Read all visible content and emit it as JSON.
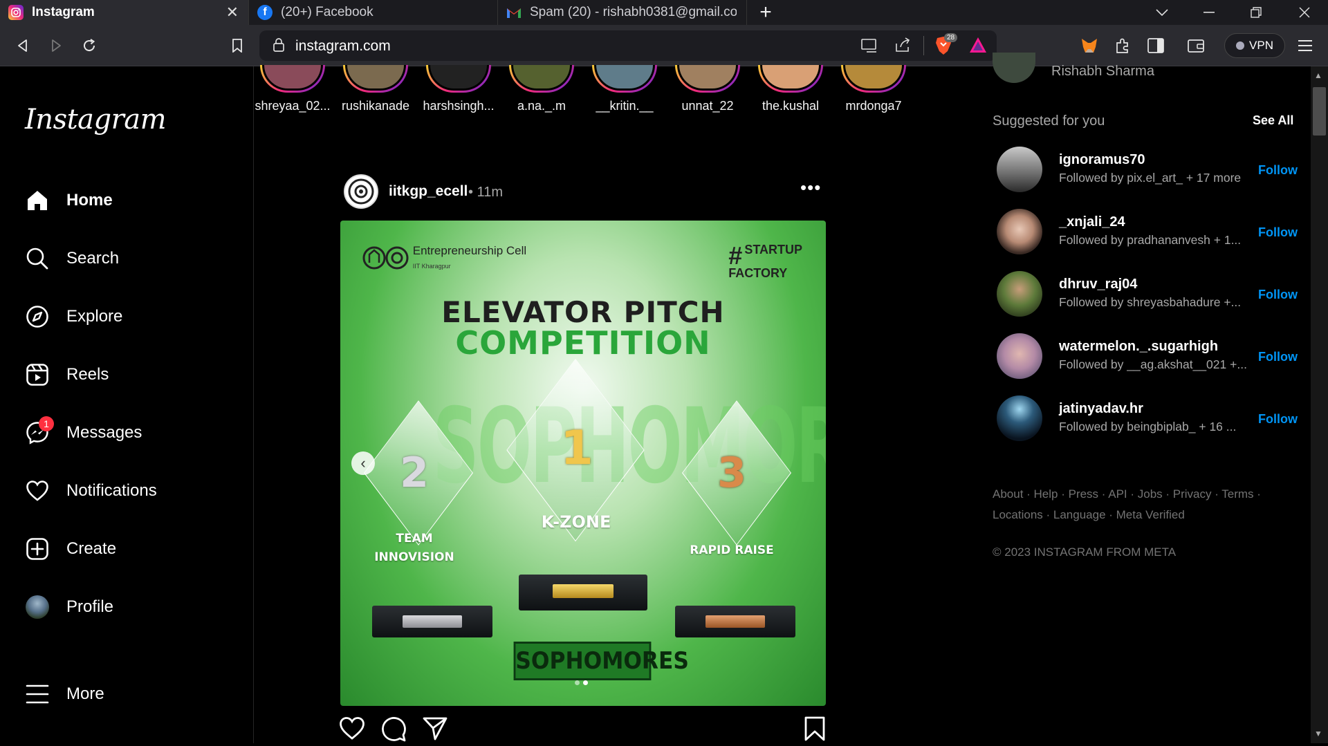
{
  "browser": {
    "tabs": [
      {
        "title": "Instagram",
        "active": true,
        "icon": "instagram-icon"
      },
      {
        "title": "(20+) Facebook",
        "active": false,
        "icon": "facebook-icon"
      },
      {
        "title": "Spam (20) - rishabh0381@gmail.com",
        "active": false,
        "icon": "gmail-icon"
      }
    ],
    "url": "instagram.com",
    "shield_count": "28",
    "vpn_label": "VPN"
  },
  "sidebar": {
    "logo": "Instagram",
    "items": [
      {
        "label": "Home",
        "icon": "home-icon"
      },
      {
        "label": "Search",
        "icon": "search-icon"
      },
      {
        "label": "Explore",
        "icon": "compass-icon"
      },
      {
        "label": "Reels",
        "icon": "reels-icon"
      },
      {
        "label": "Messages",
        "icon": "messenger-icon",
        "badge": "1"
      },
      {
        "label": "Notifications",
        "icon": "heart-icon"
      },
      {
        "label": "Create",
        "icon": "plus-square-icon"
      },
      {
        "label": "Profile",
        "icon": "avatar"
      },
      {
        "label": "More",
        "icon": "menu-icon"
      }
    ]
  },
  "stories": [
    "shreyaa_02...",
    "rushikanade",
    "harshsingh...",
    "a.na._.m",
    "__kritin.__",
    "unnat_22",
    "the.kushal",
    "mrdonga7"
  ],
  "post": {
    "username": "iitkgp_ecell",
    "time": "• 11m",
    "image": {
      "org": "Entrepreneurship Cell",
      "org_sub": "IIT Kharagpur",
      "tag_hash": "#",
      "tag_line1": "STARTUP",
      "tag_line2": "FACTORY",
      "title1": "ELEVATOR PITCH",
      "title2": "COMPETITION",
      "background_word": "SOPHOMORES",
      "trophies": [
        {
          "rank": "2",
          "label_line1": "TEAM",
          "label_line2": "INNOVISION"
        },
        {
          "rank": "1",
          "label_line1": "K-ZONE",
          "label_line2": ""
        },
        {
          "rank": "3",
          "label_line1": "RAPID RAISE",
          "label_line2": ""
        }
      ],
      "footer": "SOPHOMORES"
    },
    "carousel_index": 2,
    "carousel_total": 2
  },
  "right": {
    "me": "Rishabh Sharma",
    "suggested_title": "Suggested for you",
    "see_all": "See All",
    "follow_label": "Follow",
    "suggestions": [
      {
        "username": "ignoramus70",
        "followed_by": "Followed by pix.el_art_ + 17 more"
      },
      {
        "username": "_xnjali_24",
        "followed_by": "Followed by pradhananvesh + 1..."
      },
      {
        "username": "dhruv_raj04",
        "followed_by": "Followed by shreyasbahadure +..."
      },
      {
        "username": "watermelon._.sugarhigh",
        "followed_by": "Followed by __ag.akshat__021 +..."
      },
      {
        "username": "jatinyadav.hr",
        "followed_by": "Followed by beingbiplab_ + 16 ..."
      }
    ],
    "footer_links": "About · Help · Press · API · Jobs · Privacy · Terms · Locations · Language · Meta Verified",
    "copyright": "© 2023 INSTAGRAM FROM META"
  },
  "colors": {
    "accent": "#0095f6",
    "badge": "#ff3040",
    "background": "#000000"
  }
}
